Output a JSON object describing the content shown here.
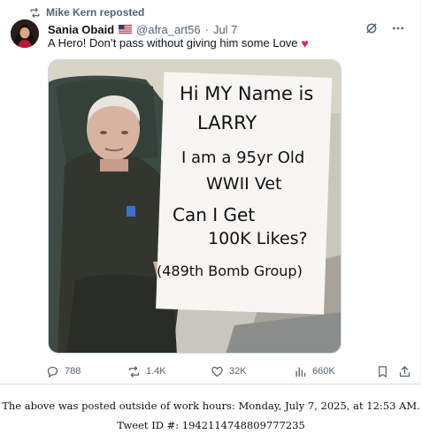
{
  "repost": {
    "label": "Mike Kern reposted"
  },
  "author": {
    "name": "Sania Obaid",
    "handle": "@afra_art56",
    "separator": "·",
    "date": "Jul 7"
  },
  "tweet": {
    "text": "A Hero! Don’t pass without giving him some Love",
    "emoji": "♥"
  },
  "sign": {
    "line1": "Hi MY Name is",
    "line2": "LARRY",
    "line3": "I am a 95yr Old",
    "line4": "WWII Vet",
    "line5": "Can I Get",
    "line6": "100K Likes?",
    "line7": "(489th Bomb Group)"
  },
  "actions": {
    "replies": "788",
    "reposts": "1.4K",
    "likes": "32K",
    "views": "660K"
  },
  "footer": {
    "line1": "The above was posted outside of work hours: Monday, July 7, 2025, at 12:53 AM.",
    "line2": "Tweet ID #: 1942114748809777235"
  },
  "colors": {
    "text": "#0f1419",
    "secondary": "#536471",
    "border": "#cfd9de",
    "heart": "#e0245e"
  },
  "icons": [
    "repost-icon",
    "us-flag-icon",
    "grok-icon",
    "more-icon",
    "reply-icon",
    "like-icon",
    "views-icon",
    "bookmark-icon",
    "share-icon"
  ]
}
